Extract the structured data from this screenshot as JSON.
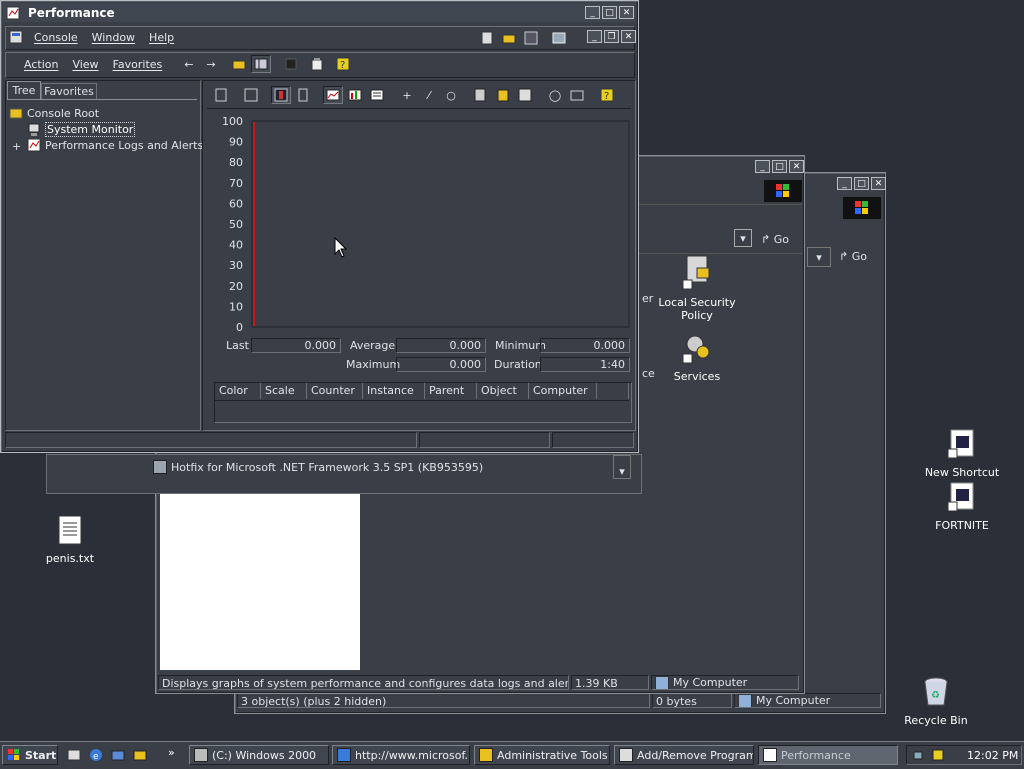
{
  "perf": {
    "title": "Performance",
    "menu": {
      "console": "Console",
      "window": "Window",
      "help": "Help"
    },
    "menu2": {
      "action": "Action",
      "view": "View",
      "favorites": "Favorites"
    },
    "tabs": {
      "tree": "Tree",
      "favorites": "Favorites"
    },
    "tree": {
      "root": "Console Root",
      "system_monitor": "System Monitor",
      "logs": "Performance Logs and Alerts",
      "expander": "+"
    },
    "stats": {
      "last_label": "Last",
      "last": "0.000",
      "avg_label": "Average",
      "avg": "0.000",
      "min_label": "Minimum",
      "min": "0.000",
      "max_label": "Maximum",
      "max": "0.000",
      "dur_label": "Duration",
      "dur": "1:40"
    },
    "columns": [
      "Color",
      "Scale",
      "Counter",
      "Instance",
      "Parent",
      "Object",
      "Computer"
    ]
  },
  "chart_data": {
    "type": "line",
    "title": "",
    "xlabel": "",
    "ylabel": "",
    "ylim": [
      0,
      100
    ],
    "yticks": [
      "100",
      "90",
      "80",
      "70",
      "60",
      "50",
      "40",
      "30",
      "20",
      "10",
      "0"
    ],
    "series": [],
    "grid": false,
    "cursor_color": "#e01010"
  },
  "admin": {
    "go": "Go",
    "icons": {
      "local_security": "Local Security Policy",
      "services": "Services",
      "partial1": "er",
      "partial2": "ce"
    },
    "status": {
      "desc": "Displays graphs of system performance and configures data logs and alerts.",
      "size": "1.39 KB",
      "location": "My Computer"
    }
  },
  "addremove": {
    "go": "Go",
    "hotfix": "Hotfix for Microsoft .NET Framework 3.5 SP1 (KB953595)",
    "status": {
      "objects": "3 object(s) (plus 2 hidden)",
      "size": "0 bytes",
      "location": "My Computer"
    }
  },
  "desktop": {
    "new_shortcut": "New Shortcut",
    "fortnite": "FORTNITE",
    "txt": "penis.txt",
    "recycle": "Recycle Bin"
  },
  "taskbar": {
    "start": "Start",
    "chevron": "»",
    "tasks": [
      "(C:) Windows 2000",
      "http://www.microsof...",
      "Administrative Tools",
      "Add/Remove Programs",
      "Performance"
    ],
    "clock": "12:02 PM"
  },
  "colors": {
    "desktop": "#2b3038",
    "window": "#3a3f47",
    "accent_red": "#e01010"
  }
}
